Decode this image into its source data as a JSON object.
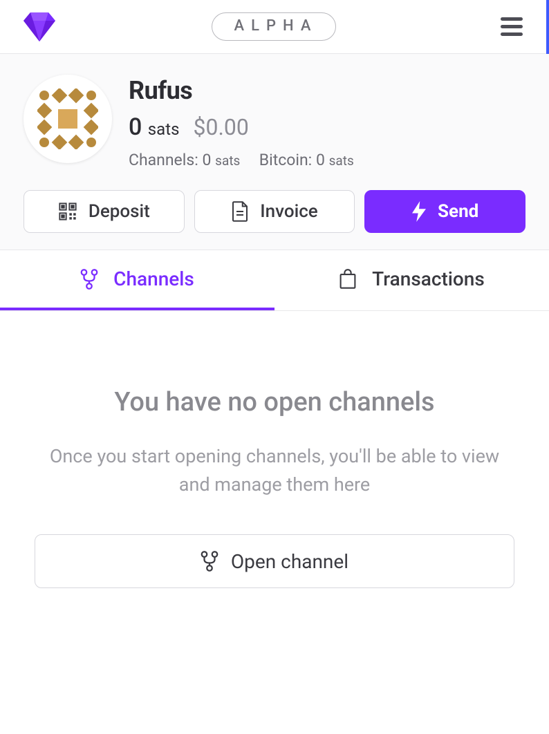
{
  "header": {
    "alpha_badge": "ALPHA"
  },
  "profile": {
    "name": "Rufus",
    "balance_sats_value": "0",
    "balance_sats_unit": "sats",
    "balance_fiat": "$0.00",
    "channels_label": "Channels:",
    "channels_value": "0",
    "channels_unit": "sats",
    "bitcoin_label": "Bitcoin:",
    "bitcoin_value": "0",
    "bitcoin_unit": "sats"
  },
  "actions": {
    "deposit": "Deposit",
    "invoice": "Invoice",
    "send": "Send"
  },
  "tabs": {
    "channels": "Channels",
    "transactions": "Transactions"
  },
  "empty": {
    "title": "You have no open channels",
    "subtitle": "Once you start opening channels, you'll be able to view and manage them here",
    "open_channel": "Open channel"
  },
  "colors": {
    "accent": "#7a2cff"
  }
}
